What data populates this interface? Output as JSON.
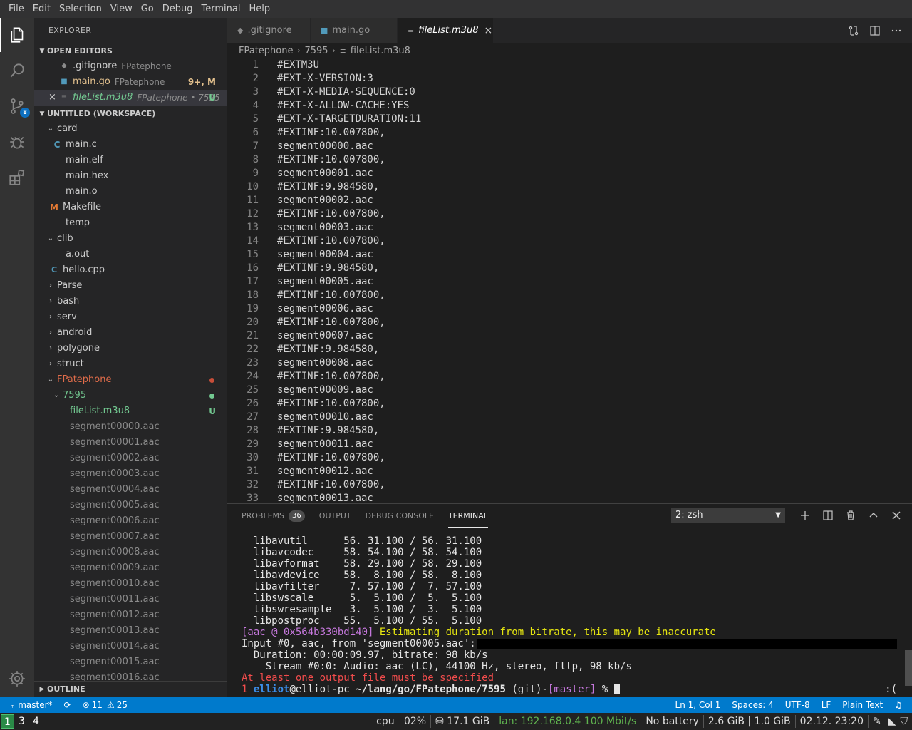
{
  "menu": [
    "File",
    "Edit",
    "Selection",
    "View",
    "Go",
    "Debug",
    "Terminal",
    "Help"
  ],
  "activity": {
    "scm_badge": "8"
  },
  "sidebar": {
    "title": "EXPLORER",
    "open_editors": {
      "header": "OPEN EDITORS",
      "items": [
        {
          "name": ".gitignore",
          "desc": "FPatephone",
          "deco": ""
        },
        {
          "name": "main.go",
          "desc": "FPatephone",
          "deco": "9+, M"
        },
        {
          "name": "fileList.m3u8",
          "desc": "FPatephone • 7595",
          "deco": "U"
        }
      ]
    },
    "workspace": {
      "header": "UNTITLED (WORKSPACE)",
      "items": [
        "card",
        "main.c",
        "main.elf",
        "main.hex",
        "main.o",
        "Makefile",
        "temp",
        "clib",
        "a.out",
        "hello.cpp",
        "Parse",
        "bash",
        "serv",
        "android",
        "polygone",
        "struct",
        "FPatephone",
        "7595",
        "fileList.m3u8",
        "segment00000.aac",
        "segment00001.aac",
        "segment00002.aac",
        "segment00003.aac",
        "segment00004.aac",
        "segment00005.aac",
        "segment00006.aac",
        "segment00007.aac",
        "segment00008.aac",
        "segment00009.aac",
        "segment00010.aac",
        "segment00011.aac",
        "segment00012.aac",
        "segment00013.aac",
        "segment00014.aac",
        "segment00015.aac",
        "segment00016.aac"
      ],
      "untracked_deco": "U"
    },
    "outline": "OUTLINE"
  },
  "tabs": [
    ".gitignore",
    "main.go",
    "fileList.m3u8"
  ],
  "breadcrumb": [
    "FPatephone",
    "7595",
    "fileList.m3u8"
  ],
  "code": {
    "line_numbers": [
      "1",
      "2",
      "3",
      "4",
      "5",
      "6",
      "7",
      "8",
      "9",
      "10",
      "11",
      "12",
      "13",
      "14",
      "15",
      "16",
      "17",
      "18",
      "19",
      "20",
      "21",
      "22",
      "23",
      "24",
      "25",
      "26",
      "27",
      "28",
      "29",
      "30",
      "31",
      "32",
      "33"
    ],
    "lines": [
      "#EXTM3U",
      "#EXT-X-VERSION:3",
      "#EXT-X-MEDIA-SEQUENCE:0",
      "#EXT-X-ALLOW-CACHE:YES",
      "#EXT-X-TARGETDURATION:11",
      "#EXTINF:10.007800,",
      "segment00000.aac",
      "#EXTINF:10.007800,",
      "segment00001.aac",
      "#EXTINF:9.984580,",
      "segment00002.aac",
      "#EXTINF:10.007800,",
      "segment00003.aac",
      "#EXTINF:10.007800,",
      "segment00004.aac",
      "#EXTINF:9.984580,",
      "segment00005.aac",
      "#EXTINF:10.007800,",
      "segment00006.aac",
      "#EXTINF:10.007800,",
      "segment00007.aac",
      "#EXTINF:9.984580,",
      "segment00008.aac",
      "#EXTINF:10.007800,",
      "segment00009.aac",
      "#EXTINF:10.007800,",
      "segment00010.aac",
      "#EXTINF:9.984580,",
      "segment00011.aac",
      "#EXTINF:10.007800,",
      "segment00012.aac",
      "#EXTINF:10.007800,",
      "segment00013.aac"
    ]
  },
  "panel": {
    "tabs": [
      "PROBLEMS",
      "OUTPUT",
      "DEBUG CONSOLE",
      "TERMINAL"
    ],
    "problems_count": "36",
    "terminal_select": "2: zsh",
    "terminal": {
      "libs": [
        "  libavutil      56. 31.100 / 56. 31.100",
        "  libavcodec     58. 54.100 / 58. 54.100",
        "  libavformat    58. 29.100 / 58. 29.100",
        "  libavdevice    58.  8.100 / 58.  8.100",
        "  libavfilter     7. 57.100 /  7. 57.100",
        "  libswscale      5.  5.100 /  5.  5.100",
        "  libswresample   3.  5.100 /  3.  5.100",
        "  libpostproc    55.  5.100 / 55.  5.100"
      ],
      "aac_prefix": "[aac @ 0x564b330bd140]",
      "aac_msg": " Estimating duration from bitrate, this may be inaccurate",
      "input": "Input #0, aac, from 'segment00005.aac':",
      "duration": "  Duration: 00:00:09.97, bitrate: 98 kb/s",
      "stream": "    Stream #0:0: Audio: aac (LC), 44100 Hz, stereo, fltp, 98 kb/s",
      "error": "At least one output file must be specified",
      "prompt_num": "1",
      "prompt_user": "elliot",
      "prompt_at": "@elliot-pc",
      "prompt_path": " ~/lang/go/FPatephone/7595",
      "prompt_git": " (git)-",
      "prompt_branch": "[master]",
      "prompt_end": " %",
      "right": ":("
    }
  },
  "status": {
    "branch": "master*",
    "errors": "11",
    "warnings": "25",
    "position": "Ln 1, Col 1",
    "spaces": "Spaces: 4",
    "encoding": "UTF-8",
    "eol": "LF",
    "language": "Plain Text"
  },
  "system": {
    "workspaces": [
      "1",
      "3",
      "4"
    ],
    "cpu_label": "cpu",
    "cpu": "02%",
    "disk": "17.1 GiB",
    "lan": "lan: 192.168.0.4 100 Mbit/s",
    "battery": "No battery",
    "mem": "2.6 GiB | 1.0 GiB",
    "datetime": "02.12. 23:20"
  }
}
